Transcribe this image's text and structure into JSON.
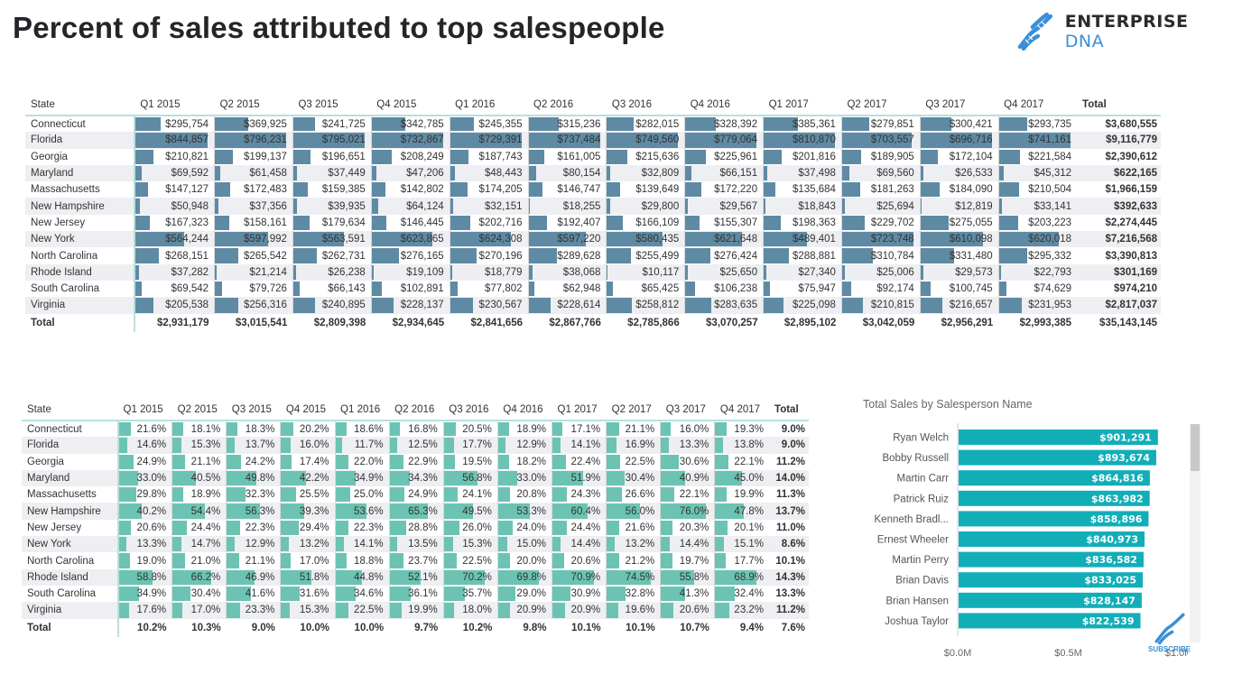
{
  "page": {
    "title": "Percent of sales attributed to top salespeople",
    "logo": {
      "icon": "dna-helix-icon",
      "brand": "ENTERPRISE",
      "brand_suffix": "DNA"
    },
    "subscribe_label": "SUBSCRIBE"
  },
  "colors": {
    "sales_bar": "#5f8aa3",
    "percent_bar": "#6cc3b3",
    "salesperson_bar": "#12aeb8",
    "logo_blue": "#3a8fd8"
  },
  "sales_table": {
    "headers": [
      "State",
      "Q1 2015",
      "Q2 2015",
      "Q3 2015",
      "Q4 2015",
      "Q1 2016",
      "Q2 2016",
      "Q3 2016",
      "Q4 2016",
      "Q1 2017",
      "Q2 2017",
      "Q3 2017",
      "Q4 2017",
      "Total"
    ],
    "rows": [
      {
        "state": "Connecticut",
        "values": [
          295754,
          369925,
          241725,
          342785,
          245355,
          315236,
          282015,
          328392,
          385361,
          279851,
          300421,
          293735
        ],
        "display": [
          "$295,754",
          "$369,925",
          "$241,725",
          "$342,785",
          "$245,355",
          "$315,236",
          "$282,015",
          "$328,392",
          "$385,361",
          "$279,851",
          "$300,421",
          "$293,735"
        ],
        "total": "$3,680,555"
      },
      {
        "state": "Florida",
        "values": [
          844857,
          796231,
          795021,
          732867,
          729391,
          737484,
          749560,
          779064,
          810870,
          703557,
          696716,
          741161
        ],
        "display": [
          "$844,857",
          "$796,231",
          "$795,021",
          "$732,867",
          "$729,391",
          "$737,484",
          "$749,560",
          "$779,064",
          "$810,870",
          "$703,557",
          "$696,716",
          "$741,161"
        ],
        "total": "$9,116,779"
      },
      {
        "state": "Georgia",
        "values": [
          210821,
          199137,
          196651,
          208249,
          187743,
          161005,
          215636,
          225961,
          201816,
          189905,
          172104,
          221584
        ],
        "display": [
          "$210,821",
          "$199,137",
          "$196,651",
          "$208,249",
          "$187,743",
          "$161,005",
          "$215,636",
          "$225,961",
          "$201,816",
          "$189,905",
          "$172,104",
          "$221,584"
        ],
        "total": "$2,390,612"
      },
      {
        "state": "Maryland",
        "values": [
          69592,
          61458,
          37449,
          47206,
          48443,
          80154,
          32809,
          66151,
          37498,
          69560,
          26533,
          45312
        ],
        "display": [
          "$69,592",
          "$61,458",
          "$37,449",
          "$47,206",
          "$48,443",
          "$80,154",
          "$32,809",
          "$66,151",
          "$37,498",
          "$69,560",
          "$26,533",
          "$45,312"
        ],
        "total": "$622,165"
      },
      {
        "state": "Massachusetts",
        "values": [
          147127,
          172483,
          159385,
          142802,
          174205,
          146747,
          139649,
          172220,
          135684,
          181263,
          184090,
          210504
        ],
        "display": [
          "$147,127",
          "$172,483",
          "$159,385",
          "$142,802",
          "$174,205",
          "$146,747",
          "$139,649",
          "$172,220",
          "$135,684",
          "$181,263",
          "$184,090",
          "$210,504"
        ],
        "total": "$1,966,159"
      },
      {
        "state": "New Hampshire",
        "values": [
          50948,
          37356,
          39935,
          64124,
          32151,
          18255,
          29800,
          29567,
          18843,
          25694,
          12819,
          33141
        ],
        "display": [
          "$50,948",
          "$37,356",
          "$39,935",
          "$64,124",
          "$32,151",
          "$18,255",
          "$29,800",
          "$29,567",
          "$18,843",
          "$25,694",
          "$12,819",
          "$33,141"
        ],
        "total": "$392,633"
      },
      {
        "state": "New Jersey",
        "values": [
          167323,
          158161,
          179634,
          146445,
          202716,
          192407,
          166109,
          155307,
          198363,
          229702,
          275055,
          203223
        ],
        "display": [
          "$167,323",
          "$158,161",
          "$179,634",
          "$146,445",
          "$202,716",
          "$192,407",
          "$166,109",
          "$155,307",
          "$198,363",
          "$229,702",
          "$275,055",
          "$203,223"
        ],
        "total": "$2,274,445"
      },
      {
        "state": "New York",
        "values": [
          564244,
          597992,
          563591,
          623865,
          624308,
          597220,
          580435,
          621648,
          489401,
          723748,
          610098,
          620018
        ],
        "display": [
          "$564,244",
          "$597,992",
          "$563,591",
          "$623,865",
          "$624,308",
          "$597,220",
          "$580,435",
          "$621,648",
          "$489,401",
          "$723,748",
          "$610,098",
          "$620,018"
        ],
        "total": "$7,216,568"
      },
      {
        "state": "North Carolina",
        "values": [
          268151,
          265542,
          262731,
          276165,
          270196,
          289628,
          255499,
          276424,
          288881,
          310784,
          331480,
          295332
        ],
        "display": [
          "$268,151",
          "$265,542",
          "$262,731",
          "$276,165",
          "$270,196",
          "$289,628",
          "$255,499",
          "$276,424",
          "$288,881",
          "$310,784",
          "$331,480",
          "$295,332"
        ],
        "total": "$3,390,813"
      },
      {
        "state": "Rhode Island",
        "values": [
          37282,
          21214,
          26238,
          19109,
          18779,
          38068,
          10117,
          25650,
          27340,
          25006,
          29573,
          22793
        ],
        "display": [
          "$37,282",
          "$21,214",
          "$26,238",
          "$19,109",
          "$18,779",
          "$38,068",
          "$10,117",
          "$25,650",
          "$27,340",
          "$25,006",
          "$29,573",
          "$22,793"
        ],
        "total": "$301,169"
      },
      {
        "state": "South Carolina",
        "values": [
          69542,
          79726,
          66143,
          102891,
          77802,
          62948,
          65425,
          106238,
          75947,
          92174,
          100745,
          74629
        ],
        "display": [
          "$69,542",
          "$79,726",
          "$66,143",
          "$102,891",
          "$77,802",
          "$62,948",
          "$65,425",
          "$106,238",
          "$75,947",
          "$92,174",
          "$100,745",
          "$74,629"
        ],
        "total": "$974,210"
      },
      {
        "state": "Virginia",
        "values": [
          205538,
          256316,
          240895,
          228137,
          230567,
          228614,
          258812,
          283635,
          225098,
          210815,
          216657,
          231953
        ],
        "display": [
          "$205,538",
          "$256,316",
          "$240,895",
          "$228,137",
          "$230,567",
          "$228,614",
          "$258,812",
          "$283,635",
          "$225,098",
          "$210,815",
          "$216,657",
          "$231,953"
        ],
        "total": "$2,817,037"
      }
    ],
    "total_row": {
      "label": "Total",
      "values": [
        "$2,931,179",
        "$3,015,541",
        "$2,809,398",
        "$2,934,645",
        "$2,841,656",
        "$2,867,766",
        "$2,785,866",
        "$3,070,257",
        "$2,895,102",
        "$3,042,059",
        "$2,956,291",
        "$2,993,385"
      ],
      "total": "$35,143,145"
    }
  },
  "percent_table": {
    "headers": [
      "State",
      "Q1 2015",
      "Q2 2015",
      "Q3 2015",
      "Q4 2015",
      "Q1 2016",
      "Q2 2016",
      "Q3 2016",
      "Q4 2016",
      "Q1 2017",
      "Q2 2017",
      "Q3 2017",
      "Q4 2017",
      "Total"
    ],
    "rows": [
      {
        "state": "Connecticut",
        "values": [
          21.6,
          18.1,
          18.3,
          20.2,
          18.6,
          16.8,
          20.5,
          18.9,
          17.1,
          21.1,
          16.0,
          19.3
        ],
        "total": "9.0%"
      },
      {
        "state": "Florida",
        "values": [
          14.6,
          15.3,
          13.7,
          16.0,
          11.7,
          12.5,
          17.7,
          12.9,
          14.1,
          16.9,
          13.3,
          13.8
        ],
        "total": "9.0%"
      },
      {
        "state": "Georgia",
        "values": [
          24.9,
          21.1,
          24.2,
          17.4,
          22.0,
          22.9,
          19.5,
          18.2,
          22.4,
          22.5,
          30.6,
          22.1
        ],
        "total": "11.2%"
      },
      {
        "state": "Maryland",
        "values": [
          33.0,
          40.5,
          49.8,
          42.2,
          34.9,
          34.3,
          56.8,
          33.0,
          51.9,
          30.4,
          40.9,
          45.0
        ],
        "total": "14.0%"
      },
      {
        "state": "Massachusetts",
        "values": [
          29.8,
          18.9,
          32.3,
          25.5,
          25.0,
          24.9,
          24.1,
          20.8,
          24.3,
          26.6,
          22.1,
          19.9
        ],
        "total": "11.3%"
      },
      {
        "state": "New Hampshire",
        "values": [
          40.2,
          54.4,
          56.3,
          39.3,
          53.6,
          65.3,
          49.5,
          53.3,
          60.4,
          56.0,
          76.0,
          47.8
        ],
        "total": "13.7%"
      },
      {
        "state": "New Jersey",
        "values": [
          20.6,
          24.4,
          22.3,
          29.4,
          22.3,
          28.8,
          26.0,
          24.0,
          24.4,
          21.6,
          20.3,
          20.1
        ],
        "total": "11.0%"
      },
      {
        "state": "New York",
        "values": [
          13.3,
          14.7,
          12.9,
          13.2,
          14.1,
          13.5,
          15.3,
          15.0,
          14.4,
          13.2,
          14.4,
          15.1
        ],
        "total": "8.6%"
      },
      {
        "state": "North Carolina",
        "values": [
          19.0,
          21.0,
          21.1,
          17.0,
          18.8,
          23.7,
          22.5,
          20.0,
          20.6,
          21.2,
          19.7,
          17.7
        ],
        "total": "10.1%"
      },
      {
        "state": "Rhode Island",
        "values": [
          58.8,
          66.2,
          46.9,
          51.8,
          44.8,
          52.1,
          70.2,
          69.8,
          70.9,
          74.5,
          55.8,
          68.9
        ],
        "total": "14.3%"
      },
      {
        "state": "South Carolina",
        "values": [
          34.9,
          30.4,
          41.6,
          31.6,
          34.6,
          36.1,
          35.7,
          29.0,
          30.9,
          32.8,
          41.3,
          32.4
        ],
        "total": "13.3%"
      },
      {
        "state": "Virginia",
        "values": [
          17.6,
          17.0,
          23.3,
          15.3,
          22.5,
          19.9,
          18.0,
          20.9,
          20.9,
          19.6,
          20.6,
          23.2
        ],
        "total": "11.2%"
      }
    ],
    "total_row": {
      "label": "Total",
      "values": [
        "10.2%",
        "10.3%",
        "9.0%",
        "10.0%",
        "10.0%",
        "9.7%",
        "10.2%",
        "9.8%",
        "10.1%",
        "10.1%",
        "10.7%",
        "9.4%"
      ],
      "total": "7.6%"
    }
  },
  "chart_data": {
    "type": "bar",
    "orientation": "horizontal",
    "title": "Total Sales by Salesperson Name",
    "categories": [
      "Ryan Welch",
      "Bobby Russell",
      "Martin Carr",
      "Patrick Ruiz",
      "Kenneth Bradl...",
      "Ernest Wheeler",
      "Martin Perry",
      "Brian Davis",
      "Brian Hansen",
      "Joshua Taylor"
    ],
    "values": [
      901291,
      893674,
      864816,
      863982,
      858896,
      840973,
      836582,
      833025,
      828147,
      822539
    ],
    "data_labels": [
      "$901,291",
      "$893,674",
      "$864,816",
      "$863,982",
      "$858,896",
      "$840,973",
      "$836,582",
      "$833,025",
      "$828,147",
      "$822,539"
    ],
    "xlabel": "",
    "ylabel": "",
    "xlim": [
      0,
      1000000
    ],
    "x_ticks": [
      {
        "value": 0,
        "label": "$0.0M"
      },
      {
        "value": 500000,
        "label": "$0.5M"
      },
      {
        "value": 1000000,
        "label": "$1.0M"
      }
    ],
    "grid": false,
    "legend": "none"
  }
}
